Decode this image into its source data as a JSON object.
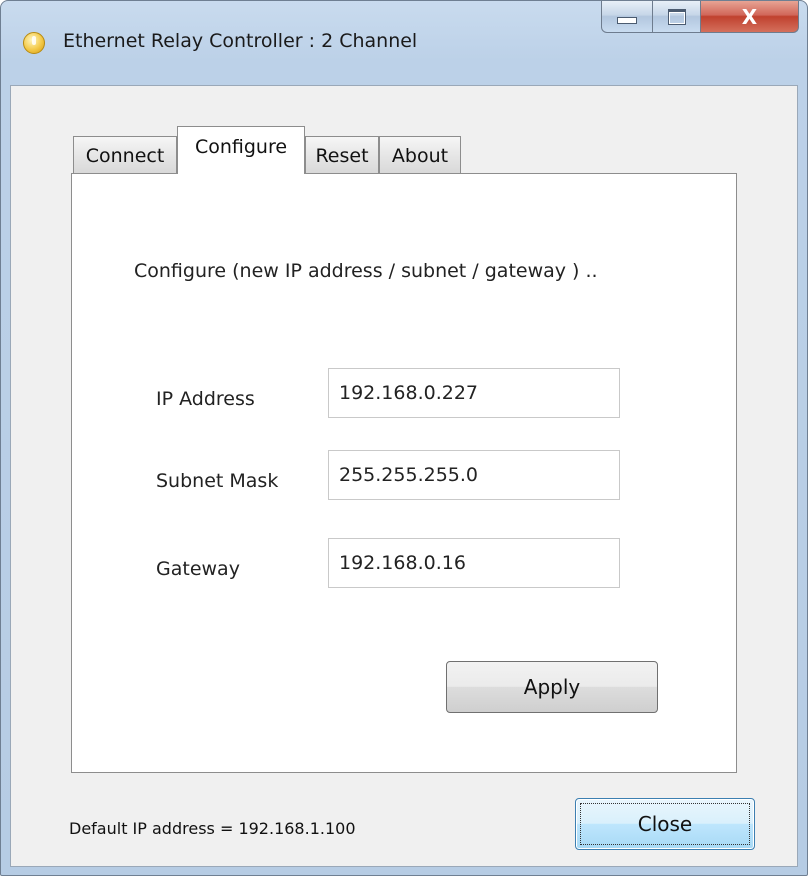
{
  "window": {
    "title": "Ethernet Relay Controller : 2 Channel",
    "app_icon": "power-icon",
    "caption_buttons": {
      "minimize_icon": "minimize-icon",
      "maximize_icon": "maximize-icon",
      "close_glyph": "X"
    },
    "accent_color": "#c0412e"
  },
  "tabs": [
    {
      "label": "Connect",
      "selected": false
    },
    {
      "label": "Configure",
      "selected": true
    },
    {
      "label": "Reset",
      "selected": false
    },
    {
      "label": "About",
      "selected": false
    }
  ],
  "configure": {
    "instruction": "Configure (new IP address / subnet / gateway ) ..",
    "fields": [
      {
        "label": "IP Address",
        "value": "192.168.0.227"
      },
      {
        "label": "Subnet Mask",
        "value": "255.255.255.0"
      },
      {
        "label": "Gateway",
        "value": "192.168.0.16"
      }
    ],
    "apply_label": "Apply"
  },
  "footer": {
    "default_ip_text": "Default IP address = 192.168.1.100",
    "close_label": "Close"
  }
}
